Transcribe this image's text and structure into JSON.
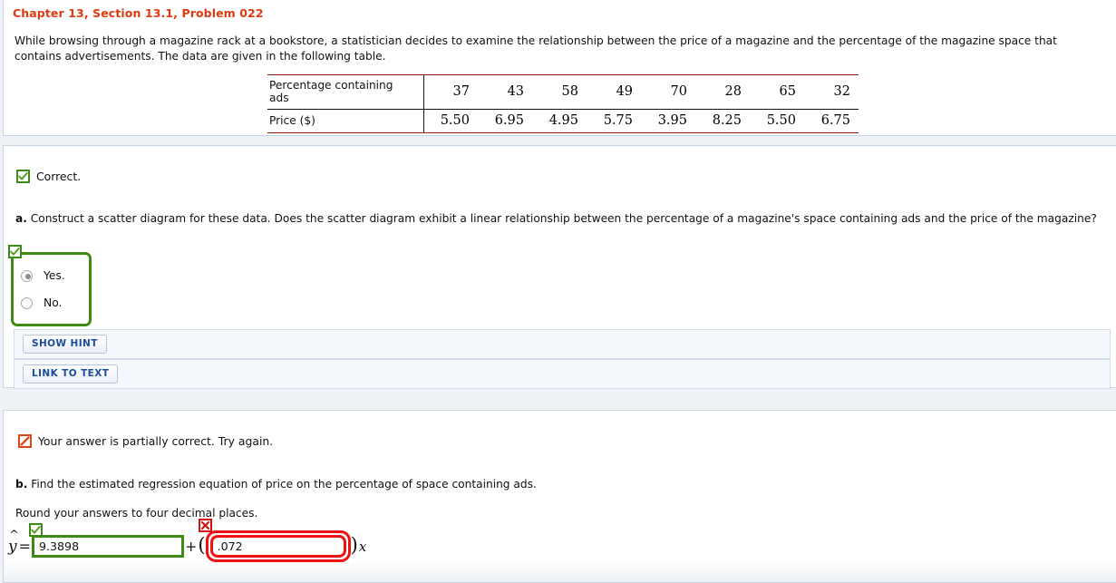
{
  "header": {
    "chapter_title": "Chapter 13, Section 13.1, Problem 022"
  },
  "problem": {
    "statement": "While browsing through a magazine rack at a bookstore, a statistician decides to examine the relationship between the price of a magazine and the percentage of the magazine space that contains advertisements. The data are given in the following table.",
    "table": {
      "row_labels": [
        "Percentage containing ads",
        "Price ($)"
      ],
      "rows": [
        [
          "37",
          "43",
          "58",
          "49",
          "70",
          "28",
          "65",
          "32"
        ],
        [
          "5.50",
          "6.95",
          "4.95",
          "5.75",
          "3.95",
          "8.25",
          "5.50",
          "6.75"
        ]
      ]
    }
  },
  "part_a": {
    "status_text": "Correct.",
    "status_icon": "check-icon",
    "question_prefix": "a.",
    "question_text": "Construct a scatter diagram for these data. Does the scatter diagram exhibit a linear relationship between the percentage of a magazine's space containing ads and the price of the magazine?",
    "options": [
      {
        "label": "Yes.",
        "selected": true
      },
      {
        "label": "No.",
        "selected": false
      }
    ],
    "buttons": [
      {
        "label": "SHOW HINT"
      },
      {
        "label": "LINK TO TEXT"
      }
    ]
  },
  "part_b": {
    "status_text": "Your answer is partially correct.  Try again.",
    "status_icon": "partial-slash-icon",
    "question_prefix": "b.",
    "question_text": "Find the estimated regression equation of price on the percentage of space containing ads.",
    "instruction": "Round your answers to four decimal places.",
    "equation": {
      "lhs": "y",
      "hat": "^",
      "equals": "=",
      "plus": "+",
      "open_paren": "(",
      "close_paren": ")",
      "x_var": "x",
      "intercept_value": "9.3898",
      "intercept_status": "correct",
      "slope_value": ".072",
      "slope_status": "incorrect"
    }
  },
  "colors": {
    "title_red": "#e03a10",
    "correct_green": "#3d8b12",
    "incorrect_red": "#ee1111",
    "partial_orange": "#e0451b",
    "button_blue": "#1c4d9c",
    "table_rule_red": "#8f1a12"
  }
}
